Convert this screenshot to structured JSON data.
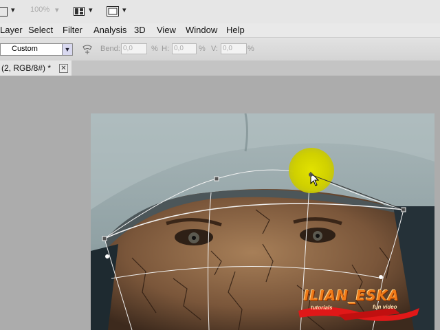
{
  "toolbar": {
    "zoom_value": "100%",
    "dropdown_arrow": "▾"
  },
  "menu": {
    "items": [
      "Layer",
      "Select",
      "Filter",
      "Analysis",
      "3D",
      "View",
      "Window",
      "Help"
    ]
  },
  "options": {
    "warp_style": "Custom",
    "bend_label": "Bend:",
    "bend_value": "0,0",
    "bend_unit": "%",
    "h_label": "H:",
    "h_value": "0,0",
    "h_unit": "%",
    "v_label": "V:",
    "v_value": "0,0",
    "v_unit": "%"
  },
  "document": {
    "tab_title": "(2, RGB/8#) *",
    "close_glyph": "✕"
  },
  "watermark": {
    "title": "ILIAN_ESKA",
    "left_text": "tutorials",
    "right_text": "fun video"
  },
  "icons": {
    "layout": "layout-icon",
    "screen_mode": "screen-mode-icon",
    "warp": "warp-orientation-icon",
    "cursor": "arrow-cursor-icon"
  },
  "colors": {
    "highlight": "#d8d800",
    "watermark_orange": "#f07a18",
    "watermark_red": "#e01818"
  }
}
